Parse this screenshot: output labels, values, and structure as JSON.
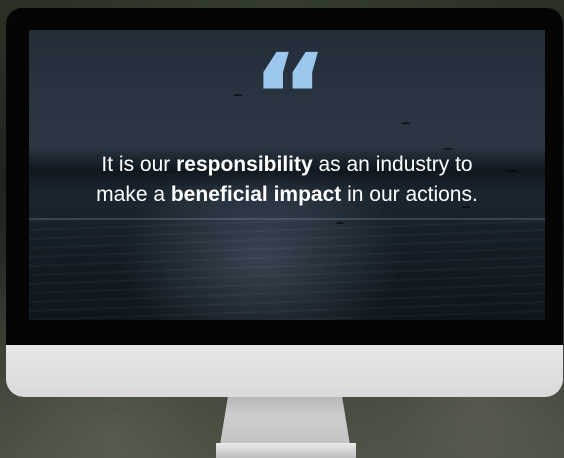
{
  "quote": {
    "mark": "“",
    "line1": {
      "before": "It is our ",
      "bold": "responsibility",
      "after": " as an industry to"
    },
    "line2": {
      "before": "make a ",
      "bold": "beneficial impact",
      "after": " in our actions."
    }
  },
  "colors": {
    "quote_mark": "#9cc7ec",
    "quote_text": "#ffffff",
    "bezel": "#050505",
    "chin": "#e0e0e0",
    "stand": "#c4c4c4"
  },
  "icons": {
    "quote_mark": "opening-quote-icon"
  }
}
